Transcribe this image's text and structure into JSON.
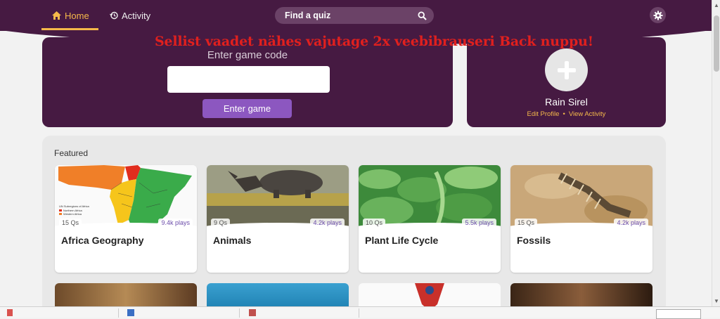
{
  "nav": {
    "home_label": "Home",
    "activity_label": "Activity"
  },
  "search": {
    "placeholder": "Find a quiz"
  },
  "warning_text": "Sellist vaadet nähes vajutage 2x veebibrauseri Back nuppu!",
  "game": {
    "code_label": "Enter game code",
    "code_value": "",
    "enter_button": "Enter game"
  },
  "profile": {
    "name": "Rain Sirel",
    "edit_link": "Edit Profile",
    "activity_link": "View Activity",
    "separator": "•"
  },
  "featured": {
    "title": "Featured",
    "cards": [
      {
        "title": "Africa Geography",
        "questions": "15 Qs",
        "plays": "9.4k plays"
      },
      {
        "title": "Animals",
        "questions": "9 Qs",
        "plays": "4.2k plays"
      },
      {
        "title": "Plant Life Cycle",
        "questions": "10 Qs",
        "plays": "5.5k plays"
      },
      {
        "title": "Fossils",
        "questions": "15 Qs",
        "plays": "4.2k plays"
      }
    ],
    "africa_legend": {
      "title": "UN Subregions of Africa",
      "items": [
        "Northern Africa",
        "Western Africa"
      ]
    }
  },
  "colors": {
    "header_bg": "#461a42",
    "accent": "#f5b94a",
    "button_purple": "#8c57c0",
    "warning_red": "#e0201e"
  }
}
